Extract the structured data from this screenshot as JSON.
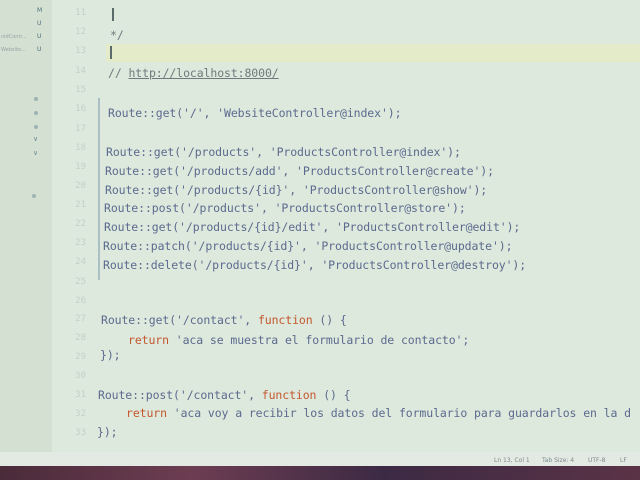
{
  "sidebar": {
    "explorer_items": [
      {
        "name": "",
        "status": "M"
      },
      {
        "name": "",
        "status": "U"
      },
      {
        "name": "nidContr...",
        "status": "U"
      },
      {
        "name": "Website...",
        "status": "U"
      }
    ]
  },
  "editor": {
    "line_numbers": [
      "11",
      "12",
      "13",
      "14",
      "15",
      "16",
      "17",
      "18",
      "19",
      "20",
      "21",
      "22",
      "23",
      "24",
      "25",
      "26",
      "27",
      "28",
      "29",
      "30",
      "31",
      "32",
      "33"
    ],
    "comment_close": "*/",
    "url_comment_prefix": "// ",
    "url_comment_link": "http://localhost:8000/",
    "lines": {
      "l16": "Route::get('/', 'WebsiteController@index');",
      "l18": "Route::get('/products', 'ProductsController@index');",
      "l19": "Route::get('/products/add', 'ProductsController@create');",
      "l20": "Route::get('/products/{id}', 'ProductsController@show');",
      "l21": "Route::post('/products', 'ProductsController@store');",
      "l22": "Route::get('/products/{id}/edit', 'ProductsController@edit');",
      "l23": "Route::patch('/products/{id}', 'ProductsController@update');",
      "l24": "Route::delete('/products/{id}', 'ProductsController@destroy');",
      "l27_pre": "Route::get('/contact', ",
      "l27_kw": "function",
      "l27_post": " () {",
      "l28_kw": "return",
      "l28_str": " 'aca se muestra el formulario de contacto';",
      "l29": "});",
      "l31_pre": "Route::post('/contact', ",
      "l31_kw": "function",
      "l31_post": " () {",
      "l32_kw": "return",
      "l32_str": " 'aca voy a recibir los datos del formulario para guardarlos en la d",
      "l33": "});"
    }
  },
  "status_bar": {
    "position": "Ln 13, Col 1",
    "tab_size": "Tab Size: 4",
    "encoding": "UTF-8",
    "eol": "LF"
  },
  "colors": {
    "background": "#dde9dc",
    "keyword": "#c4572f",
    "string": "#5c6a8f",
    "line_highlight": "#e3ebc8"
  }
}
